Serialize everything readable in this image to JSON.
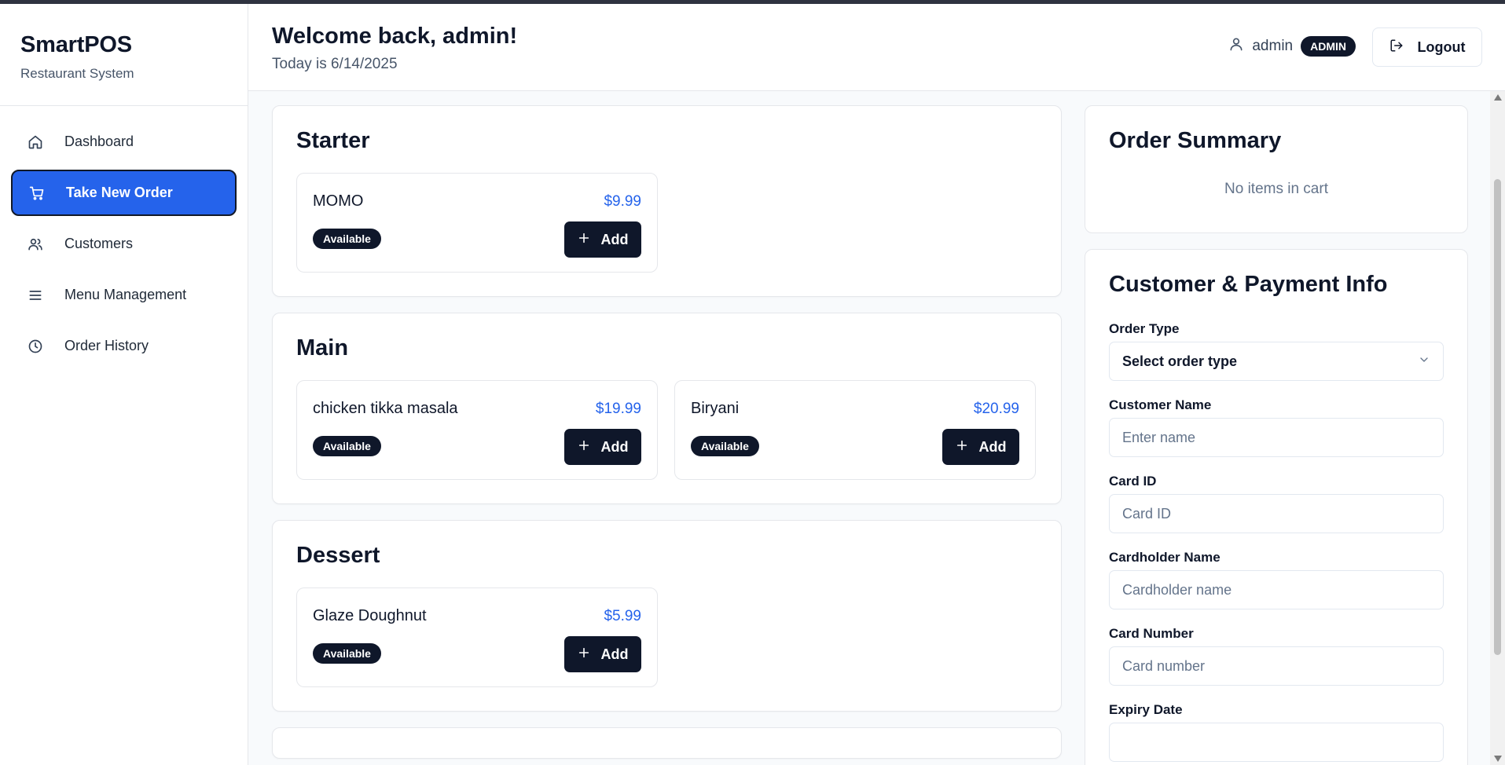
{
  "brand": {
    "title": "SmartPOS",
    "subtitle": "Restaurant System"
  },
  "sidebar": {
    "items": [
      {
        "label": "Dashboard",
        "icon": "home-icon",
        "active": false
      },
      {
        "label": "Take New Order",
        "icon": "cart-icon",
        "active": true
      },
      {
        "label": "Customers",
        "icon": "users-icon",
        "active": false
      },
      {
        "label": "Menu Management",
        "icon": "menu-lines-icon",
        "active": false
      },
      {
        "label": "Order History",
        "icon": "clock-icon",
        "active": false
      }
    ]
  },
  "header": {
    "welcome": "Welcome back, admin!",
    "today": "Today is 6/14/2025",
    "user_name": "admin",
    "role": "ADMIN",
    "logout_label": "Logout"
  },
  "menu": {
    "add_label": "Add",
    "categories": [
      {
        "title": "Starter",
        "items": [
          {
            "name": "MOMO",
            "price": "$9.99",
            "status": "Available"
          }
        ]
      },
      {
        "title": "Main",
        "items": [
          {
            "name": "chicken tikka masala",
            "price": "$19.99",
            "status": "Available"
          },
          {
            "name": "Biryani",
            "price": "$20.99",
            "status": "Available"
          }
        ]
      },
      {
        "title": "Dessert",
        "items": [
          {
            "name": "Glaze Doughnut",
            "price": "$5.99",
            "status": "Available"
          }
        ]
      }
    ]
  },
  "order_summary": {
    "title": "Order Summary",
    "empty_text": "No items in cart"
  },
  "payment": {
    "title": "Customer & Payment Info",
    "order_type_label": "Order Type",
    "order_type_value": "Select order type",
    "customer_name_label": "Customer Name",
    "customer_name_placeholder": "Enter name",
    "card_id_label": "Card ID",
    "card_id_placeholder": "Card ID",
    "cardholder_label": "Cardholder Name",
    "cardholder_placeholder": "Cardholder name",
    "card_number_label": "Card Number",
    "card_number_placeholder": "Card number",
    "expiry_label": "Expiry Date"
  },
  "colors": {
    "accent": "#2563eb",
    "dark": "#0f172a",
    "muted": "#64748b"
  }
}
